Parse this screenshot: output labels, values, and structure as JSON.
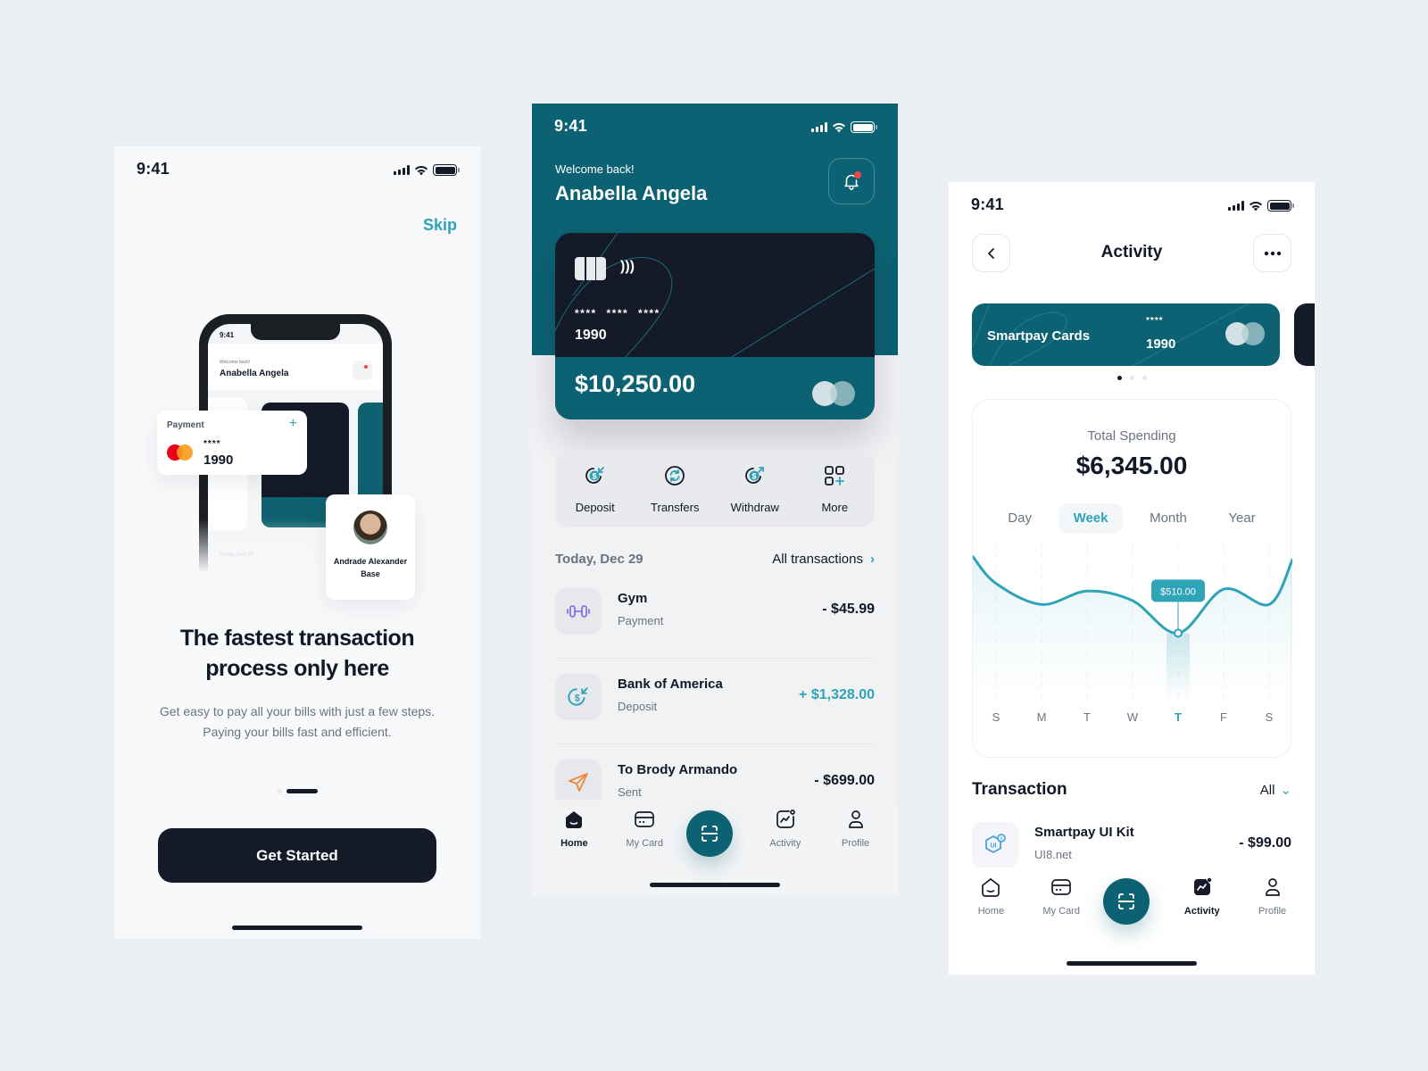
{
  "colors": {
    "background": "#eceff3",
    "primary": "#0c6272",
    "accent": "#2fa3b8",
    "dark": "#141a28",
    "alert": "#ef4444"
  },
  "onboarding": {
    "status_time": "9:41",
    "skip_label": "Skip",
    "mockup": {
      "time": "9:41",
      "welcome": "Welcome back!",
      "name": "Anabella Angela",
      "date": "Today, Dec 29"
    },
    "payment_card": {
      "label": "Payment",
      "add_icon": "+",
      "masked": "****",
      "last4": "1990"
    },
    "contact_card": {
      "name": "Andrade Alexander Base"
    },
    "title": "The fastest transaction process only here",
    "description": "Get easy to pay all your bills with just a few steps. Paying your bills fast and efficient.",
    "pager": {
      "total": 2,
      "active": 2
    },
    "cta_label": "Get Started"
  },
  "home": {
    "status_time": "9:41",
    "welcome": "Welcome back!",
    "user_name": "Anabella Angela",
    "card": {
      "masked": "**** **** ****",
      "last4": "1990",
      "balance": "$10,250.00",
      "nfc": ")))"
    },
    "actions": [
      {
        "label": "Deposit",
        "icon": "deposit-icon"
      },
      {
        "label": "Transfers",
        "icon": "transfers-icon"
      },
      {
        "label": "Withdraw",
        "icon": "withdraw-icon"
      },
      {
        "label": "More",
        "icon": "more-grid-icon"
      }
    ],
    "section_date": "Today, Dec 29",
    "all_transactions_label": "All transactions",
    "transactions": [
      {
        "title": "Gym",
        "subtitle": "Payment",
        "amount": "- $45.99",
        "icon": "dumbbell-icon",
        "type": "debit"
      },
      {
        "title": "Bank of America",
        "subtitle": "Deposit",
        "amount": "+ $1,328.00",
        "icon": "deposit-icon",
        "type": "credit"
      },
      {
        "title": "To Brody Armando",
        "subtitle": "Sent",
        "amount": "- $699.00",
        "icon": "send-icon",
        "type": "debit"
      }
    ],
    "nav": [
      {
        "label": "Home",
        "active": true
      },
      {
        "label": "My Card",
        "active": false
      },
      {
        "label": "",
        "scan": true
      },
      {
        "label": "Activity",
        "active": false
      },
      {
        "label": "Profile",
        "active": false
      }
    ]
  },
  "activity": {
    "status_time": "9:41",
    "title": "Activity",
    "card": {
      "label": "Smartpay Cards",
      "masked": "****",
      "last4": "1990"
    },
    "card_pager": {
      "total": 3,
      "active": 1
    },
    "total_label": "Total Spending",
    "total_value": "$6,345.00",
    "periods": [
      "Day",
      "Week",
      "Month",
      "Year"
    ],
    "active_period": "Week",
    "section_title": "Transaction",
    "filter_label": "All",
    "transactions": [
      {
        "title": "Smartpay UI Kit",
        "subtitle": "UI8.net",
        "amount": "- $99.00",
        "icon": "ui8-icon"
      }
    ],
    "nav": [
      {
        "label": "Home",
        "active": false
      },
      {
        "label": "My Card",
        "active": false
      },
      {
        "label": "",
        "scan": true
      },
      {
        "label": "Activity",
        "active": true
      },
      {
        "label": "Profile",
        "active": false
      }
    ]
  },
  "chart_data": {
    "type": "line",
    "title": "Total Spending",
    "categories": [
      "S",
      "M",
      "T",
      "W",
      "T",
      "F",
      "S"
    ],
    "values": [
      640,
      585,
      620,
      595,
      510,
      625,
      585
    ],
    "highlight_index": 4,
    "highlight_label": "$510.00",
    "ylim": [
      350,
      700
    ],
    "grid": "vertical dashed",
    "xlabel": "",
    "ylabel": ""
  }
}
